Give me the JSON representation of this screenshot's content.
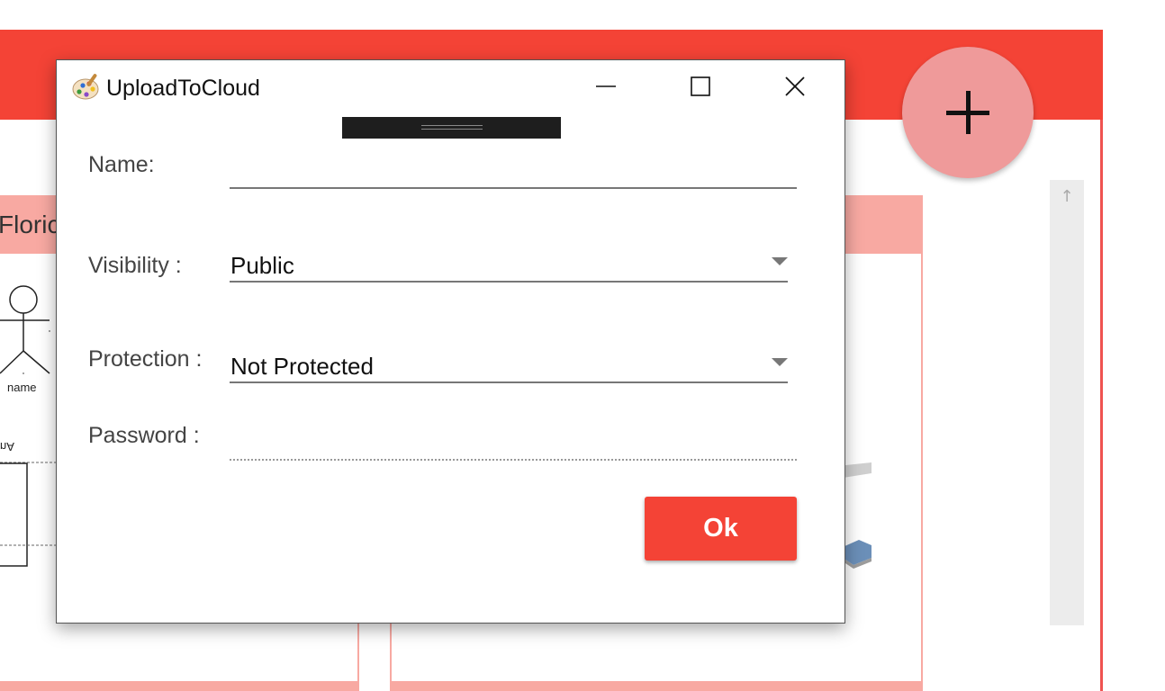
{
  "background": {
    "card1_title": "Floric",
    "thumbnail_name_label": "name",
    "thumbnail_flipped_label": "nA",
    "fab_icon": "plus-icon",
    "scroll_up_glyph": "↑",
    "colors": {
      "primary": "#f44336",
      "card_header": "#f8a9a2",
      "fab": "#ef9a9a"
    }
  },
  "dialog": {
    "title": "UploadToCloud",
    "icon": "palette-icon",
    "controls": {
      "minimize": "minimize-icon",
      "maximize": "maximize-icon",
      "close": "close-icon"
    },
    "fields": {
      "name": {
        "label": "Name:",
        "value": ""
      },
      "visibility": {
        "label": "Visibility :",
        "value": "Public"
      },
      "protection": {
        "label": "Protection :",
        "value": "Not Protected"
      },
      "password": {
        "label": "Password :",
        "value": ""
      }
    },
    "ok_label": "Ok"
  }
}
